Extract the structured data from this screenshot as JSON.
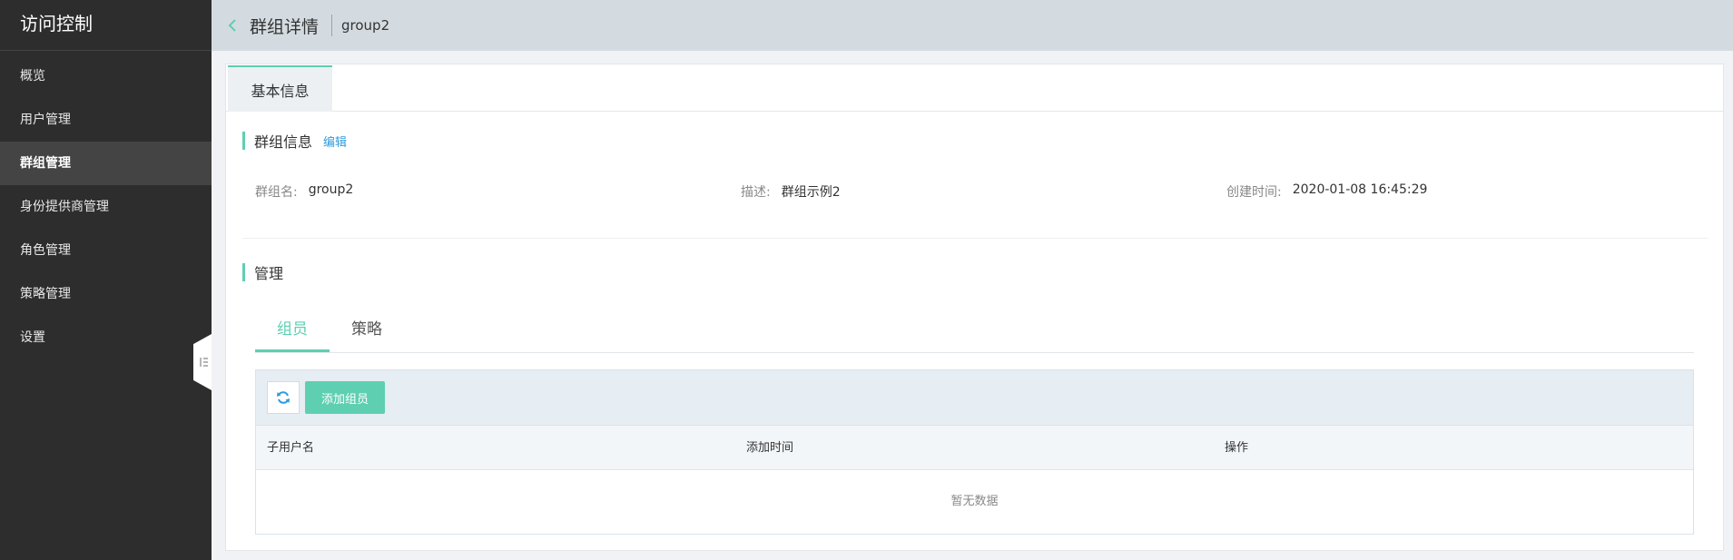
{
  "sidebar": {
    "title": "访问控制",
    "items": [
      {
        "label": "概览",
        "active": false
      },
      {
        "label": "用户管理",
        "active": false
      },
      {
        "label": "群组管理",
        "active": true
      },
      {
        "label": "身份提供商管理",
        "active": false
      },
      {
        "label": "角色管理",
        "active": false
      },
      {
        "label": "策略管理",
        "active": false
      },
      {
        "label": "设置",
        "active": false
      }
    ],
    "collapse_icon": "collapse-left-icon"
  },
  "header": {
    "back_icon": "chevron-left-icon",
    "title": "群组详情",
    "subtitle": "group2"
  },
  "tabs": {
    "basic_info": "基本信息"
  },
  "group_info": {
    "section_title": "群组信息",
    "edit_label": "编辑",
    "name_label": "群组名:",
    "name_value": "group2",
    "desc_label": "描述:",
    "desc_value": "群组示例2",
    "created_label": "创建时间:",
    "created_value": "2020-01-08 16:45:29"
  },
  "manage": {
    "section_title": "管理",
    "subtabs": [
      {
        "label": "组员",
        "active": true
      },
      {
        "label": "策略",
        "active": false
      }
    ],
    "refresh_icon": "refresh-icon",
    "add_button": "添加组员",
    "columns": [
      "子用户名",
      "添加时间",
      "操作"
    ],
    "empty_text": "暂无数据"
  },
  "colors": {
    "accent": "#5ecfb1",
    "link": "#2f9bdc",
    "sidebar_bg": "#2d2d2d",
    "header_bg": "#d4dbe0"
  }
}
